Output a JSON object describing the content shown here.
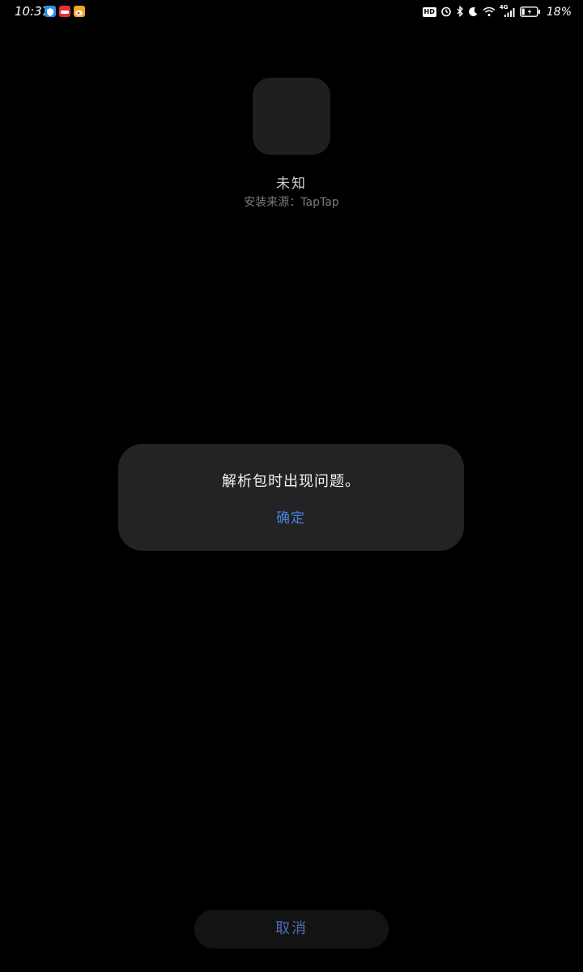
{
  "status_bar": {
    "time": "10:37",
    "network_type": "4G",
    "battery_percent": "18%",
    "app_icons": [
      "shield-app-icon",
      "red-app-icon",
      "weibo-app-icon"
    ],
    "indicators": [
      "hd-icon",
      "alarm-icon",
      "bluetooth-icon",
      "moon-icon",
      "wifi-icon",
      "signal-icon",
      "battery-icon"
    ],
    "hd_label": "HD"
  },
  "app": {
    "name": "未知",
    "install_source": "安装来源：TapTap"
  },
  "dialog": {
    "message": "解析包时出现问题。",
    "confirm_label": "确定"
  },
  "footer": {
    "cancel_label": "取消"
  },
  "colors": {
    "background": "#000000",
    "dialog_bg": "#232325",
    "accent": "#4c7fe0",
    "app_icon_bg": "#1f1f20"
  }
}
